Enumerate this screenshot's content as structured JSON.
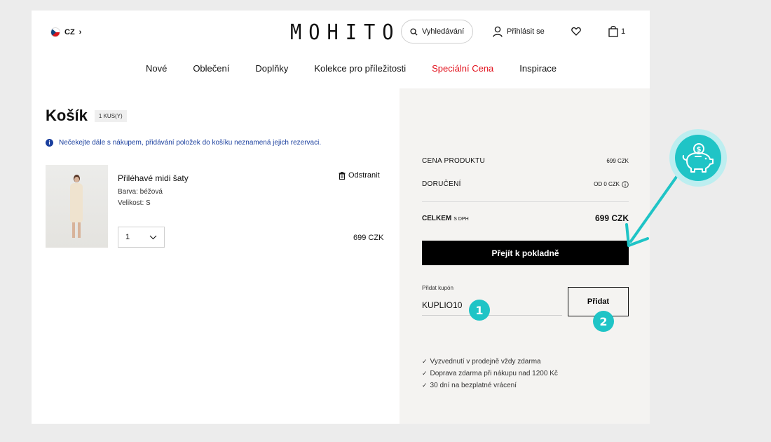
{
  "header": {
    "lang": "CZ",
    "logo": "MOHITO",
    "search_label": "Vyhledávání",
    "login_label": "Přihlásit se",
    "bag_count": "1"
  },
  "nav": [
    {
      "label": "Nové"
    },
    {
      "label": "Oblečení"
    },
    {
      "label": "Doplňky"
    },
    {
      "label": "Kolekce pro příležitosti"
    },
    {
      "label": "Speciální Cena"
    },
    {
      "label": "Inspirace"
    }
  ],
  "cart": {
    "title": "Košík",
    "count_badge": "1 KUS(Y)",
    "notice": "Nečekejte dále s nákupem, přidávání položek do košíku neznamená jejich rezervaci.",
    "item": {
      "name": "Přiléhavé midi šaty",
      "color": "Barva: béžová",
      "size": "Velikost: S",
      "remove_label": "Odstranit",
      "quantity": "1",
      "price": "699 CZK"
    }
  },
  "summary": {
    "product_price_label": "CENA PRODUKTU",
    "product_price": "699 CZK",
    "delivery_label": "DORUČENÍ",
    "delivery_value": "OD 0 CZK",
    "total_label": "CELKEM",
    "total_sub": "S DPH",
    "total_value": "699 CZK",
    "checkout_label": "Přejít k pokladně",
    "coupon_label": "Přidat kupón",
    "coupon_value": "KUPLIO10",
    "add_label": "Přidat",
    "perks": [
      "Vyzvednutí v prodejně vždy zdarma",
      "Doprava zdarma při nákupu nad 1200 Kč",
      "30 dní na bezplatné vrácení"
    ]
  },
  "annotations": {
    "step1": "1",
    "step2": "2",
    "accent_color": "#1fc4c6"
  }
}
